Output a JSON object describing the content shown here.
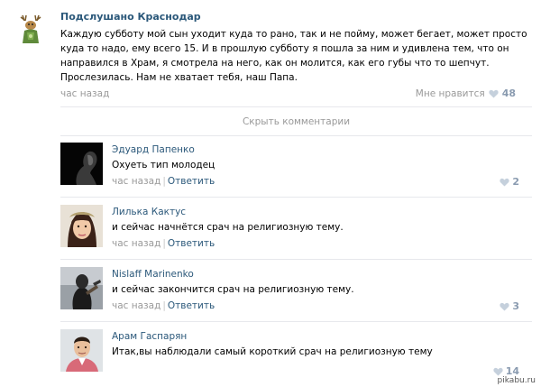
{
  "post": {
    "author": "Подслушано Краснодар",
    "text": "Каждую субботу мой сын уходит куда то рано, так и не пойму, может бегает, может просто куда то надо, ему всего 15. И в прошлую субботу я пошла за ним и удивлена тем, что он направился в Храм, я смотрела на него, как он молится, как его губы что то шепчут. Прослезилась. Нам не хватает тебя, наш Папа.",
    "time": "час назад",
    "like_label": "Мне нравится",
    "like_count": "48",
    "like_icon": "heart-icon"
  },
  "hide_comments_label": "Скрыть комментарии",
  "comments": [
    {
      "author": "Эдуард Папенко",
      "text": "Охуеть тип молодец",
      "time": "час назад",
      "reply": "Ответить",
      "likes": "2"
    },
    {
      "author": "Лилька Кактус",
      "text": "и сейчас начнётся срач на религиозную тему.",
      "time": "час назад",
      "reply": "Ответить",
      "likes": ""
    },
    {
      "author": "Nislaff Marinenko",
      "text": "и сейчас закончится срач на религиозную тему.",
      "time": "час назад",
      "reply": "Ответить",
      "likes": "3"
    },
    {
      "author": "Арам Гаспарян",
      "text": "Итак,вы наблюдали самый короткий срач на религиозную тему",
      "time": "",
      "reply": "",
      "likes": "14"
    }
  ],
  "watermark": "pikabu.ru",
  "colors": {
    "link": "#2b587a",
    "muted": "#999999",
    "like": "#8a9bb0",
    "divider": "#e7e8ec"
  }
}
